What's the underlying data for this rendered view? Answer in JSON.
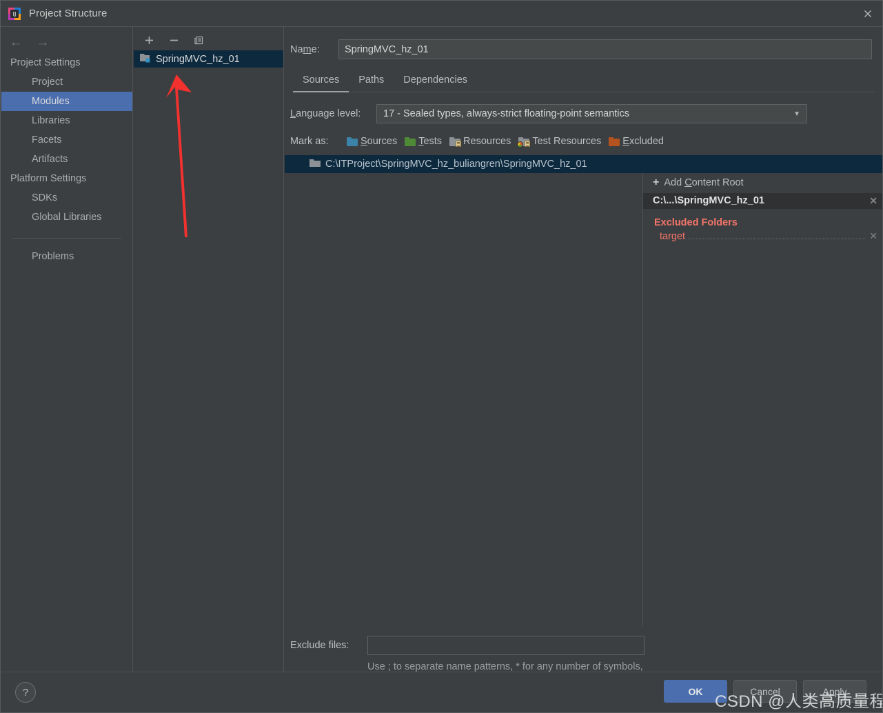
{
  "window": {
    "title": "Project Structure",
    "app_icon": "intellij-idea-icon",
    "close_label": "✕"
  },
  "sidebar": {
    "back_label": "←",
    "forward_label": "→",
    "groups": [
      {
        "label": "Project Settings",
        "items": [
          {
            "label": "Project",
            "selected": false
          },
          {
            "label": "Modules",
            "selected": true
          },
          {
            "label": "Libraries",
            "selected": false
          },
          {
            "label": "Facets",
            "selected": false
          },
          {
            "label": "Artifacts",
            "selected": false
          }
        ]
      },
      {
        "label": "Platform Settings",
        "items": [
          {
            "label": "SDKs",
            "selected": false
          },
          {
            "label": "Global Libraries",
            "selected": false
          }
        ]
      }
    ],
    "problems_label": "Problems"
  },
  "modules_panel": {
    "toolbar": {
      "add_label": "+",
      "remove_label": "−",
      "copy_label": "copy-icon"
    },
    "items": [
      {
        "label": "SpringMVC_hz_01",
        "icon": "module-icon",
        "selected": true
      }
    ]
  },
  "main": {
    "name_label": "Name:",
    "name_value": "SpringMVC_hz_01",
    "tabs": [
      {
        "label": "Sources",
        "active": true
      },
      {
        "label": "Paths",
        "active": false
      },
      {
        "label": "Dependencies",
        "active": false
      }
    ],
    "language_level_label": "Language level:",
    "language_level_value": "17 - Sealed types, always-strict floating-point semantics",
    "caret_glyph": "▼",
    "mark_as_label": "Mark as:",
    "mark_as_options": [
      {
        "label": "Sources",
        "icon": "folder-sources-icon",
        "color": "#3b83a8"
      },
      {
        "label": "Tests",
        "icon": "folder-tests-icon",
        "color": "#4f8a37"
      },
      {
        "label": "Resources",
        "icon": "folder-resources-icon",
        "color": "#8c9196"
      },
      {
        "label": "Test Resources",
        "icon": "folder-test-resources-icon",
        "color": "#8c9196"
      },
      {
        "label": "Excluded",
        "icon": "folder-excluded-icon",
        "color": "#b4531f"
      }
    ],
    "content_root_path": "C:\\ITProject\\SpringMVC_hz_buliangren\\SpringMVC_hz_01",
    "add_content_root_label": "Add Content Root",
    "add_content_root_plus": "+",
    "root_entry_label": "C:\\...\\SpringMVC_hz_01",
    "excluded_folders_label": "Excluded Folders",
    "excluded_folders": [
      "target"
    ],
    "remove_glyph": "✕",
    "exclude_files_label": "Exclude files:",
    "exclude_files_value": "",
    "exclude_files_hint": "Use ; to separate name patterns, * for any number of symbols, ? for one."
  },
  "footer": {
    "help_label": "?",
    "buttons": [
      {
        "label": "OK",
        "style": "primary"
      },
      {
        "label": "Cancel",
        "style": "normal"
      },
      {
        "label": "Apply",
        "style": "normal"
      }
    ]
  },
  "annotations": {
    "arrow_color": "#f3312e",
    "watermark_text": "CSDN @人类高质量程序员"
  }
}
